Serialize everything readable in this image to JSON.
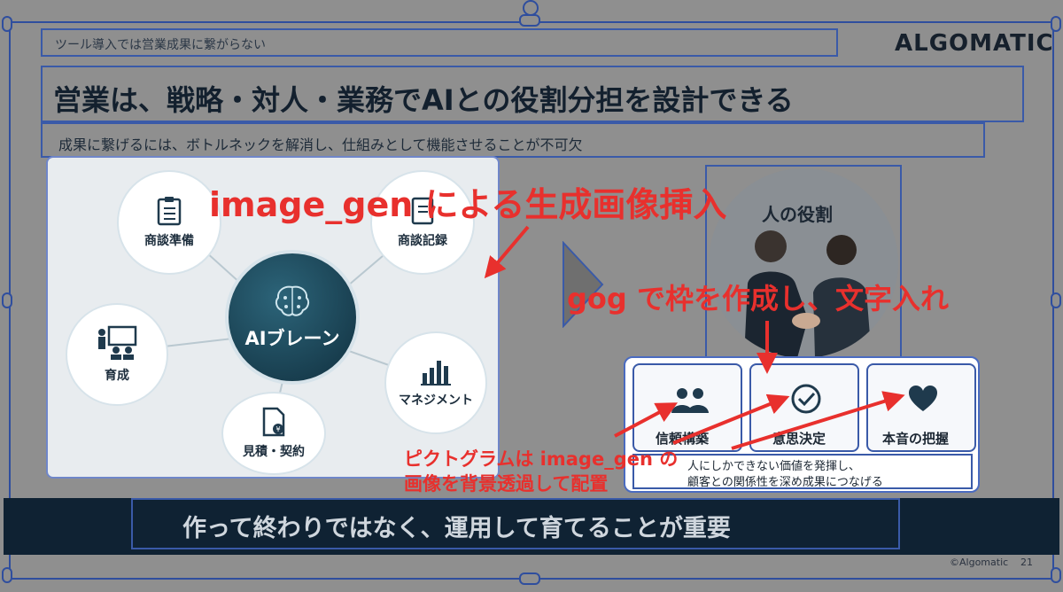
{
  "slide": {
    "header_label": "ツール導入では営業成果に繋がらない",
    "logo": "ALGOMATIC",
    "title": "営業は、戦略・対人・業務でAIとの役割分担を設計できる",
    "subtitle": "成果に繋げるには、ボトルネックを解消し、仕組みとして機能させることが不可欠",
    "footer_message": "作って終わりではなく、運用して育てることが重要",
    "copyright": "©Algomatic",
    "page_number": "21"
  },
  "diagram": {
    "center": "AIブレーン",
    "nodes": [
      {
        "label": "商談準備",
        "icon": "clipboard-icon"
      },
      {
        "label": "商談記録",
        "icon": "notebook-icon"
      },
      {
        "label": "育成",
        "icon": "teaching-icon"
      },
      {
        "label": "マネジメント",
        "icon": "bar-chart-icon"
      },
      {
        "label": "見積・契約",
        "icon": "document-yen-icon"
      }
    ]
  },
  "human_role": {
    "title": "人の役割",
    "cards": [
      {
        "label": "信頼構築",
        "icon": "people-icon"
      },
      {
        "label": "意思決定",
        "icon": "check-circle-icon"
      },
      {
        "label": "本音の把握",
        "icon": "heart-icon"
      }
    ],
    "desc_line1": "人にしかできない価値を発揮し、",
    "desc_line2": "顧客との関係性を深め成果につなげる"
  },
  "annotations": {
    "image_gen": "image_gen による生成画像挿入",
    "gog": "gog で枠を作成し、文字入れ",
    "pictogram_line1": "ピクトグラムは image_gen の",
    "pictogram_line2": "画像を背景透過して配置"
  },
  "colors": {
    "navy": "#0f2233",
    "annotation_red": "#e8302d",
    "selection_blue": "#2f4e9e",
    "teal_center": "#1d4b5e"
  }
}
